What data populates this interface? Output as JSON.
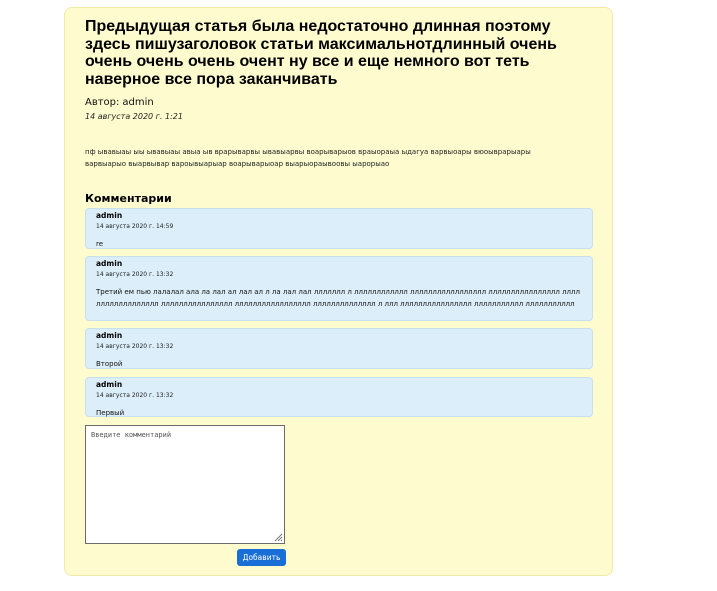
{
  "article": {
    "title": "Предыдущая статья была недостаточно длинная поэтому здесь пишузаголовок статьи максимальнотдлинный очень очень очень очень очент ну все и еще немного вот теть наверное все пора заканчивать",
    "author_label": "Автор:",
    "author": "admin",
    "date": "14 августа 2020 г. 1:21",
    "body": "пф ывавыаы ыы ывавыаы авыа ыв врарыварвы ывавыарвы воарыварыов враыораыа ыдагуа варвыоары вюоыврарыары варвыарыо выарвывар вароывыарыар воарыварыоар выарыораывоовы ыарорыао"
  },
  "comments": {
    "heading": "Комментарии",
    "items": [
      {
        "author": "admin",
        "date": "14 августа 2020 г. 14:59",
        "text": "re"
      },
      {
        "author": "admin",
        "date": "14 августа 2020 г. 13:32",
        "text": "Третий ем пью лалалал ала ла лал ал лал ал л ла лал лал ллллллл л лллллллллллл ллллллллллллллллл лллллллллллллллл лллллллллллллллллл лллллллллллллллл ллллллллллллллллл лллллллллллллл л ллл лллллллллллллллл ллллллллллл ллллллллллл"
      },
      {
        "author": "admin",
        "date": "14 августа 2020 г. 13:32",
        "text": "Второй"
      },
      {
        "author": "admin",
        "date": "14 августа 2020 г. 13:32",
        "text": "Первый"
      }
    ]
  },
  "form": {
    "placeholder": "Введите комментарий",
    "value": "",
    "submit_label": "Добавить"
  },
  "colors": {
    "card_background": "#fefccf",
    "comment_background": "#dbeef9",
    "button": "#1a6fd6"
  }
}
